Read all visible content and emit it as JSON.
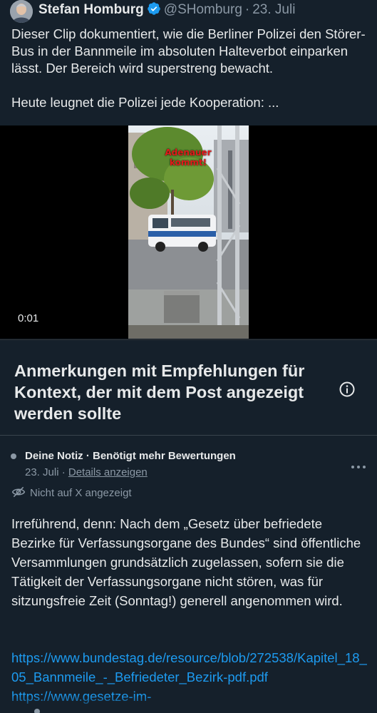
{
  "tweet": {
    "author_name": "Stefan Homburg",
    "handle": "@SHomburg",
    "separator": "·",
    "date": "23. Juli",
    "text_paragraph_1": "Dieser Clip dokumentiert, wie die Berliner Polizei den Störer-Bus in der Bannmeile im absoluten Halteverbot einparken lässt. Der Bereich wird superstreng bewacht.",
    "text_paragraph_2": "Heute leugnet die Polizei jede Kooperation: ..."
  },
  "video": {
    "overlay_text": "Adenauer kommt!",
    "timestamp": "0:01"
  },
  "note_header": {
    "title": "Anmerkungen mit Empfehlungen für Kontext, der mit dem Post angezeigt werden sollte",
    "info_icon": "info-circle-icon"
  },
  "note": {
    "meta": "Deine Notiz · Benötigt mehr Bewertungen",
    "date": "23. Juli",
    "separator": "·",
    "details_link": "Details anzeigen",
    "not_shown": "Nicht auf X angezeigt",
    "body": "Irreführend, denn: Nach dem „Gesetz über befriedete Bezirke für Verfassungsorgane des Bundes“ sind öffentliche Versammlungen grundsätzlich zugelassen, sofern sie die Tätigkeit der Verfassungsorgane nicht stören, was für sitzungsfreie Zeit (Sonntag!) generell angenommen wird.",
    "links": [
      "https://www.bundestag.de/resource/blob/272538/Kapitel_18_05_Bannmeile_-_Befriedeter_Bezirk-pdf.pdf",
      "https://www.gesetze-im-"
    ]
  },
  "colors": {
    "background": "#15202b",
    "text": "#e7e9ea",
    "muted": "#8b98a5",
    "link": "#1d9bf0",
    "verified": "#1d9bf0"
  }
}
